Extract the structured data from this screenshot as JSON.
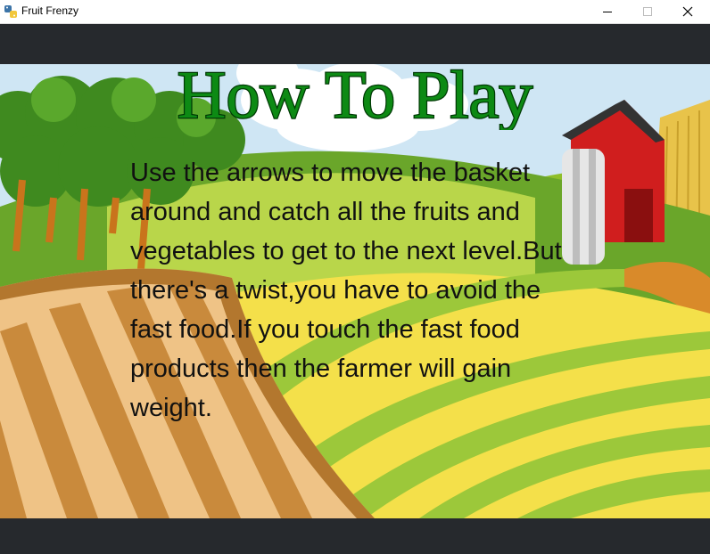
{
  "window": {
    "title": "Fruit Frenzy",
    "app_icon": "python-icon",
    "controls": {
      "minimize": "minimize-icon",
      "maximize": "maximize-icon",
      "close": "close-icon"
    }
  },
  "screen": {
    "heading": "How To Play",
    "instructions": "Use the arrows to move the basket around and catch all the fruits and vegetables to get to the next level.But there's a twist,you have to avoid the fast food.If you touch the fast food products then the farmer will gain weight."
  },
  "colors": {
    "heading_fill": "#0d8a14",
    "heading_outline": "#003a05",
    "letterbox": "#26292d",
    "sky": "#cfe6f4",
    "barn": "#d01e1e"
  }
}
